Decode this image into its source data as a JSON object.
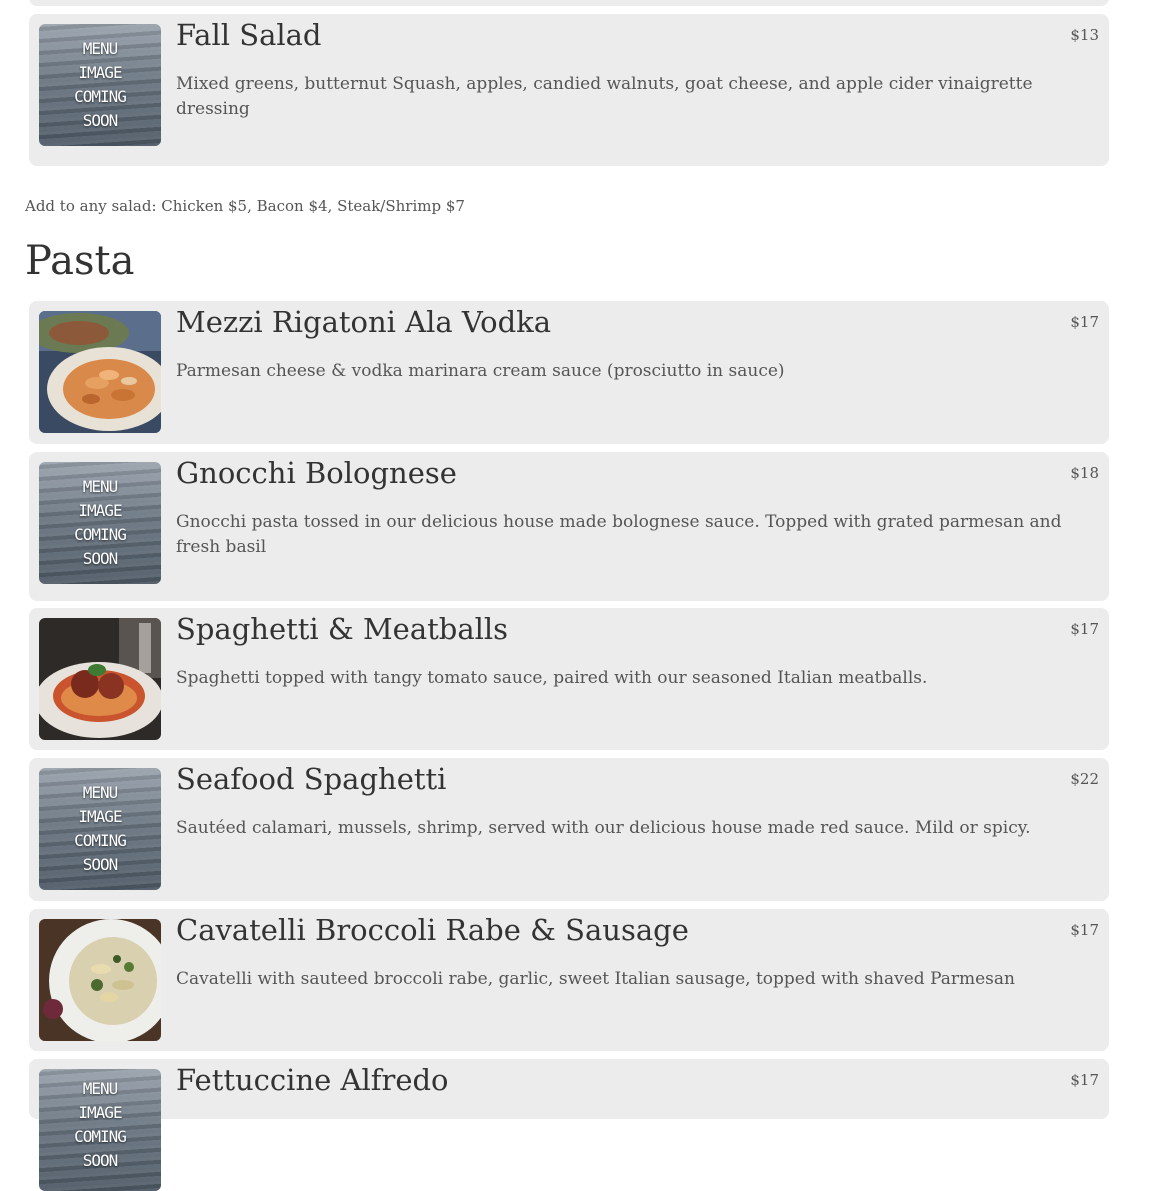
{
  "salad_addons_note": "Add to any salad: Chicken $5, Bacon $4, Steak/Shrimp $7",
  "pasta_section_title": "Pasta",
  "placeholder_text": "MENU\nIMAGE\nCOMING\nSOON",
  "items": [
    {
      "name": "Fall Salad",
      "price": "$13",
      "description": "Mixed greens, butternut Squash, apples, candied walnuts, goat cheese, and apple cider vinaigrette dressing",
      "image": "placeholder"
    },
    {
      "name": "Mezzi Rigatoni Ala Vodka",
      "price": "$17",
      "description": "Parmesan cheese & vodka marinara cream sauce (prosciutto in sauce)",
      "image": "rigatoni-photo"
    },
    {
      "name": "Gnocchi Bolognese",
      "price": "$18",
      "description": "Gnocchi pasta tossed in our delicious house made bolognese sauce. Topped with grated parmesan and fresh basil",
      "image": "placeholder"
    },
    {
      "name": "Spaghetti & Meatballs",
      "price": "$17",
      "description": "Spaghetti topped with tangy tomato sauce, paired with our seasoned Italian meatballs.",
      "image": "spaghetti-photo"
    },
    {
      "name": "Seafood Spaghetti",
      "price": "$22",
      "description": "Sautéed calamari, mussels, shrimp, served with our delicious house made red sauce. Mild or spicy.",
      "image": "placeholder"
    },
    {
      "name": "Cavatelli Broccoli Rabe & Sausage",
      "price": "$17",
      "description": "Cavatelli with sauteed broccoli rabe, garlic, sweet Italian sausage, topped with shaved Parmesan",
      "image": "cavatelli-photo"
    },
    {
      "name": "Fettuccine Alfredo",
      "price": "$17",
      "description": "",
      "image": "placeholder"
    }
  ]
}
